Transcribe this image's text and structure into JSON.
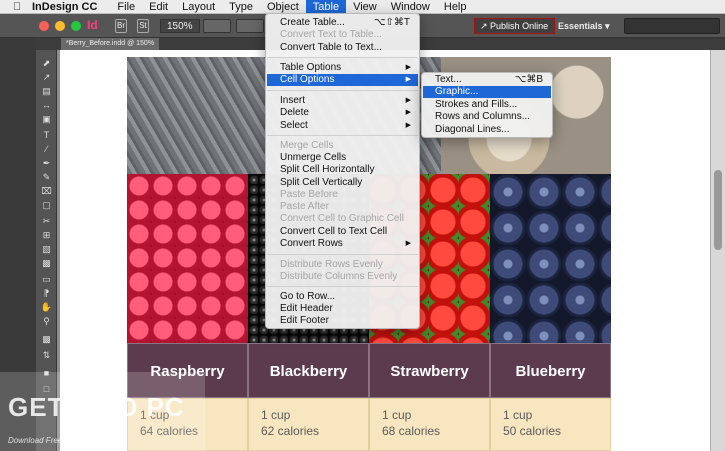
{
  "menubar": {
    "app_name": "InDesign CC",
    "items": [
      "File",
      "Edit",
      "Layout",
      "Type",
      "Object",
      "Table",
      "View",
      "Window",
      "Help"
    ],
    "active": "Table"
  },
  "appbar": {
    "logo": "Id",
    "zoom": "150%",
    "publish_label": "Publish Online",
    "workspace_label": "Essentials",
    "colors": {
      "publish_border": "#aa1111",
      "accent": "#1e67d6"
    }
  },
  "document": {
    "tab_label": "*Berry_Before.indd @ 150%"
  },
  "table_menu": {
    "items": [
      {
        "label": "Create Table...",
        "shortcut": "⌥⇧⌘T",
        "enabled": true
      },
      {
        "label": "Convert Text to Table...",
        "enabled": false
      },
      {
        "label": "Convert Table to Text...",
        "enabled": true
      },
      {
        "label": "Table Options",
        "submenu": true,
        "enabled": true
      },
      {
        "label": "Cell Options",
        "submenu": true,
        "enabled": true,
        "highlighted": true
      },
      {
        "label": "Insert",
        "submenu": true,
        "enabled": true
      },
      {
        "label": "Delete",
        "submenu": true,
        "enabled": true
      },
      {
        "label": "Select",
        "submenu": true,
        "enabled": true
      },
      {
        "label": "Merge Cells",
        "enabled": false
      },
      {
        "label": "Unmerge Cells",
        "enabled": true
      },
      {
        "label": "Split Cell Horizontally",
        "enabled": true
      },
      {
        "label": "Split Cell Vertically",
        "enabled": true
      },
      {
        "label": "Paste Before",
        "enabled": false
      },
      {
        "label": "Paste After",
        "enabled": false
      },
      {
        "label": "Convert Cell to Graphic Cell",
        "enabled": false
      },
      {
        "label": "Convert Cell to Text Cell",
        "enabled": true
      },
      {
        "label": "Convert Rows",
        "submenu": true,
        "enabled": true
      },
      {
        "label": "Distribute Rows Evenly",
        "enabled": false
      },
      {
        "label": "Distribute Columns Evenly",
        "enabled": false
      },
      {
        "label": "Go to Row...",
        "enabled": true
      },
      {
        "label": "Edit Header",
        "enabled": true
      },
      {
        "label": "Edit Footer",
        "enabled": true
      }
    ]
  },
  "cell_options_submenu": {
    "items": [
      {
        "label": "Text...",
        "shortcut": "⌥⌘B",
        "highlighted": false
      },
      {
        "label": "Graphic...",
        "highlighted": true
      },
      {
        "label": "Strokes and Fills...",
        "highlighted": false
      },
      {
        "label": "Rows and Columns...",
        "highlighted": false
      },
      {
        "label": "Diagonal Lines...",
        "highlighted": false
      }
    ]
  },
  "berry_table": {
    "columns": [
      {
        "name": "Raspberry",
        "amount": "1 cup",
        "calories": "64 calories"
      },
      {
        "name": "Blackberry",
        "amount": "1 cup",
        "calories": "62 calories"
      },
      {
        "name": "Strawberry",
        "amount": "1 cup",
        "calories": "68 calories"
      },
      {
        "name": "Blueberry",
        "amount": "1 cup",
        "calories": "50 calories"
      }
    ],
    "header_color": "#5c3b4e",
    "body_color": "#f7e6bf"
  },
  "watermark": {
    "title": "GET INTO PC",
    "subtitle": "Download Free Your Desired App"
  }
}
